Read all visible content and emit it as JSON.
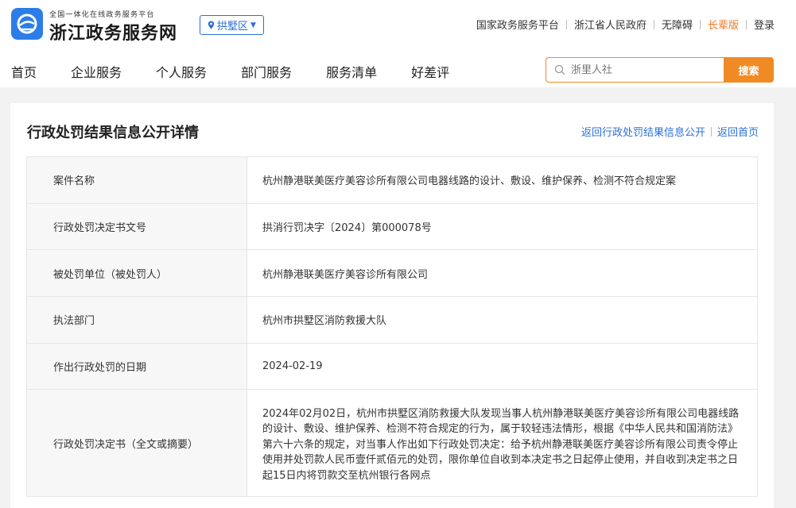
{
  "header": {
    "logo_small": "全国一体化在线政务服务平台",
    "logo_big": "浙江政务服务网",
    "region": "拱墅区",
    "top_links": [
      "国家政务服务平台",
      "浙江省人民政府",
      "无障碍",
      "长辈版",
      "登录"
    ],
    "nav": [
      "首页",
      "企业服务",
      "个人服务",
      "部门服务",
      "服务清单",
      "好差评"
    ],
    "search_placeholder": "浙里人社",
    "search_button": "搜索",
    "accent_color": "#f08a24",
    "link_color": "#2c6fd6"
  },
  "detail": {
    "title": "行政处罚结果信息公开详情",
    "back_list_link": "返回行政处罚结果信息公开",
    "back_home_link": "返回首页",
    "rows": [
      {
        "label": "案件名称",
        "value": "杭州静港联美医疗美容诊所有限公司电器线路的设计、敷设、维护保养、检测不符合规定案"
      },
      {
        "label": "行政处罚决定书文号",
        "value": "拱消行罚决字〔2024〕第000078号"
      },
      {
        "label": "被处罚单位（被处罚人）",
        "value": "杭州静港联美医疗美容诊所有限公司"
      },
      {
        "label": "执法部门",
        "value": "杭州市拱墅区消防救援大队"
      },
      {
        "label": "作出行政处罚的日期",
        "value": "2024-02-19"
      },
      {
        "label": "行政处罚决定书（全文或摘要）",
        "value": "2024年02月02日，杭州市拱墅区消防救援大队发现当事人杭州静港联美医疗美容诊所有限公司电器线路的设计、敷设、维护保养、检测不符合规定的行为，属于较轻违法情形，根据《中华人民共和国消防法》第六十六条的规定，对当事人作出如下行政处罚决定：给予杭州静港联美医疗美容诊所有限公司责令停止使用并处罚款人民币壹仟贰佰元的处罚，限你单位自收到本决定书之日起停止使用，并自收到决定书之日起15日内将罚款交至杭州银行各网点"
      }
    ]
  }
}
